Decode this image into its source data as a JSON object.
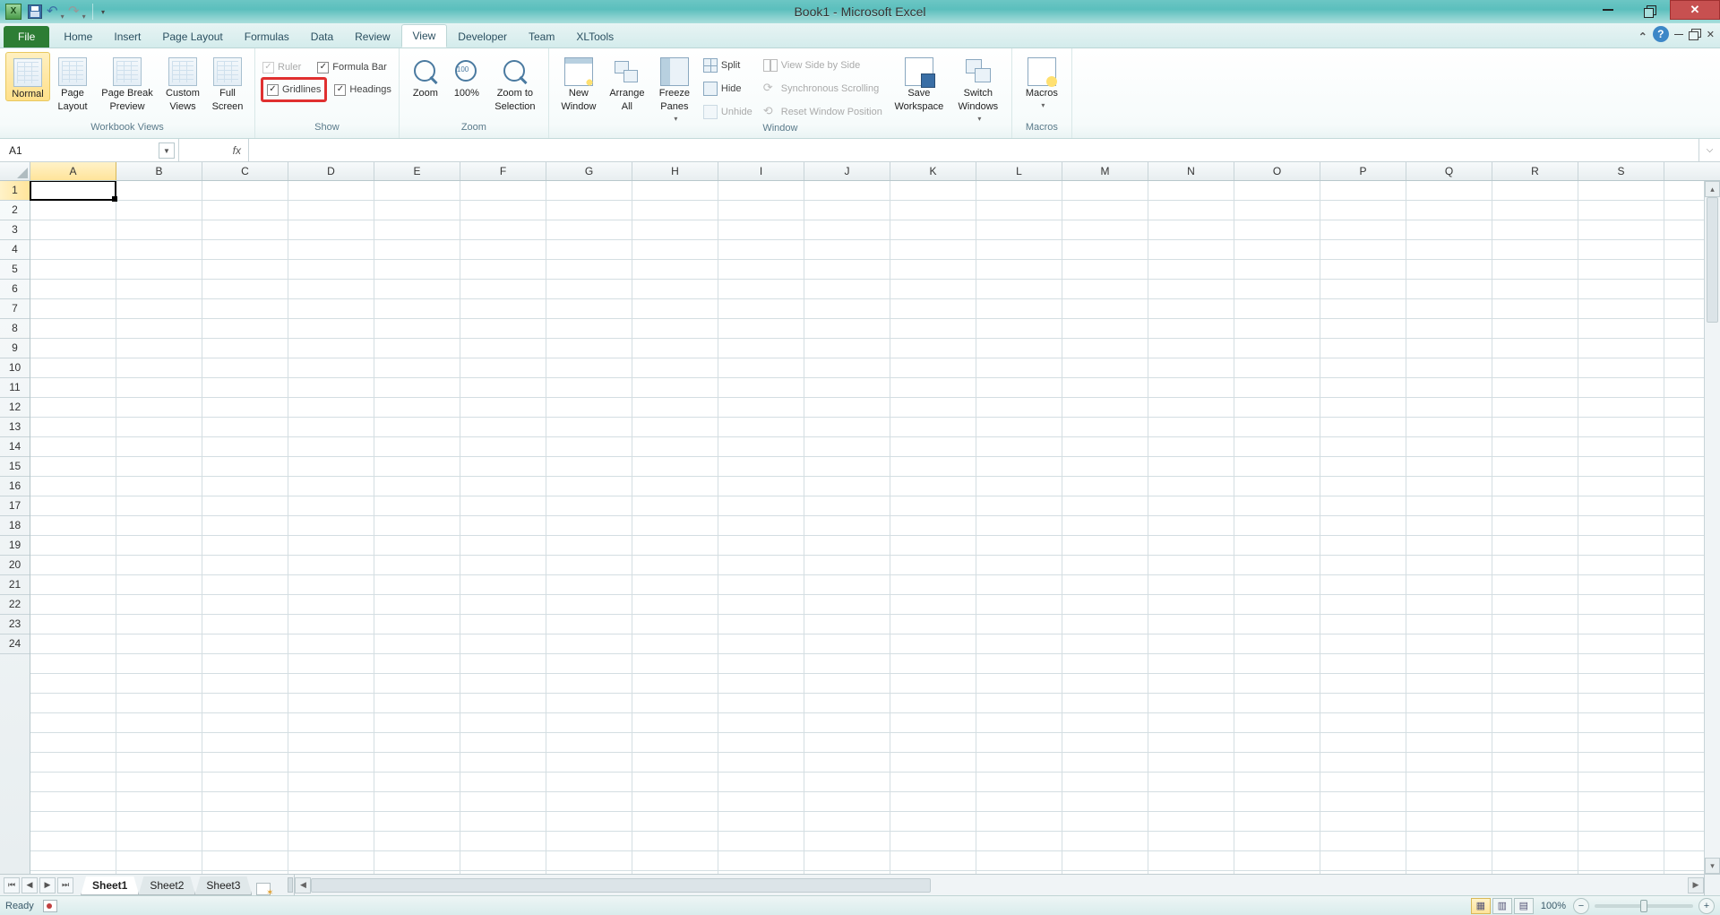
{
  "app": {
    "title": "Book1 - Microsoft Excel"
  },
  "qat": {
    "undo_enabled": true,
    "redo_enabled": false
  },
  "tabs": {
    "file": "File",
    "items": [
      "Home",
      "Insert",
      "Page Layout",
      "Formulas",
      "Data",
      "Review",
      "View",
      "Developer",
      "Team",
      "XLTools"
    ],
    "active": "View"
  },
  "ribbon": {
    "groups": {
      "workbook_views": {
        "label": "Workbook Views",
        "normal": "Normal",
        "page_layout_1": "Page",
        "page_layout_2": "Layout",
        "page_break_1": "Page Break",
        "page_break_2": "Preview",
        "custom_1": "Custom",
        "custom_2": "Views",
        "full_1": "Full",
        "full_2": "Screen"
      },
      "show": {
        "label": "Show",
        "ruler": "Ruler",
        "formula_bar": "Formula Bar",
        "gridlines": "Gridlines",
        "headings": "Headings"
      },
      "zoom": {
        "label": "Zoom",
        "zoom": "Zoom",
        "hundred": "100%",
        "zoom_to_1": "Zoom to",
        "zoom_to_2": "Selection"
      },
      "window": {
        "label": "Window",
        "new_1": "New",
        "new_2": "Window",
        "arrange_1": "Arrange",
        "arrange_2": "All",
        "freeze_1": "Freeze",
        "freeze_2": "Panes",
        "split": "Split",
        "hide": "Hide",
        "unhide": "Unhide",
        "side_by_side": "View Side by Side",
        "sync_scroll": "Synchronous Scrolling",
        "reset_pos": "Reset Window Position",
        "save_wk_1": "Save",
        "save_wk_2": "Workspace",
        "switch_1": "Switch",
        "switch_2": "Windows"
      },
      "macros": {
        "label": "Macros",
        "macros": "Macros"
      }
    }
  },
  "formula_bar": {
    "name_box": "A1",
    "fx": "fx",
    "formula": ""
  },
  "grid": {
    "columns": [
      "A",
      "B",
      "C",
      "D",
      "E",
      "F",
      "G",
      "H",
      "I",
      "J",
      "K",
      "L",
      "M",
      "N",
      "O",
      "P",
      "Q",
      "R",
      "S"
    ],
    "rows": [
      "1",
      "2",
      "3",
      "4",
      "5",
      "6",
      "7",
      "8",
      "9",
      "10",
      "11",
      "12",
      "13",
      "14",
      "15",
      "16",
      "17",
      "18",
      "19",
      "20",
      "21",
      "22",
      "23",
      "24"
    ],
    "selected_col": "A",
    "selected_row": "1"
  },
  "sheets": {
    "nav": [
      "⏮",
      "◀",
      "▶",
      "⏭"
    ],
    "tabs": [
      "Sheet1",
      "Sheet2",
      "Sheet3"
    ],
    "active": "Sheet1"
  },
  "status": {
    "ready": "Ready",
    "zoom": "100%",
    "minus": "−",
    "plus": "+"
  }
}
